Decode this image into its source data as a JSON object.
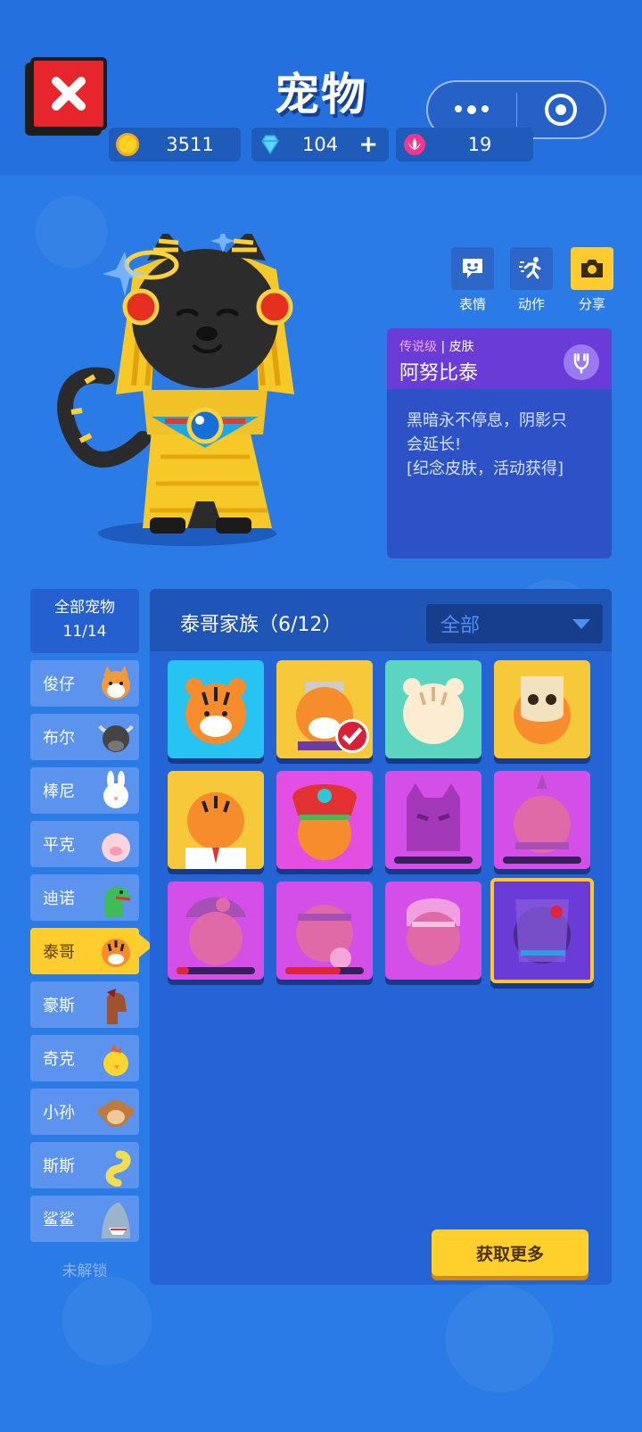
{
  "header": {
    "title": "宠物",
    "currencies": [
      {
        "icon": "coin-icon",
        "value": "3511"
      },
      {
        "icon": "diamond-icon",
        "value": "104",
        "plus": "+"
      },
      {
        "icon": "lotus-icon",
        "value": "19"
      }
    ]
  },
  "actions": [
    {
      "icon": "emote-icon",
      "label": "表情"
    },
    {
      "icon": "action-icon",
      "label": "动作"
    },
    {
      "icon": "camera-icon",
      "label": "分享"
    }
  ],
  "skin": {
    "rarity": "传说级",
    "separator": "|",
    "type": "皮肤",
    "name": "阿努比泰",
    "desc_line1": "黑暗永不停息，阴影只",
    "desc_line2": "会延长!",
    "desc_line3": "[纪念皮肤，活动获得]"
  },
  "sidebar": {
    "all_label": "全部宠物",
    "all_count": "11/14",
    "items": [
      {
        "label": "俊仔",
        "icon": "shiba-icon"
      },
      {
        "label": "布尔",
        "icon": "bull-icon"
      },
      {
        "label": "棒尼",
        "icon": "bunny-icon"
      },
      {
        "label": "平克",
        "icon": "pig-icon"
      },
      {
        "label": "迪诺",
        "icon": "dino-icon"
      },
      {
        "label": "泰哥",
        "icon": "tiger-icon",
        "active": true
      },
      {
        "label": "豪斯",
        "icon": "horse-icon"
      },
      {
        "label": "奇克",
        "icon": "chick-icon"
      },
      {
        "label": "小孙",
        "icon": "monkey-icon"
      },
      {
        "label": "斯斯",
        "icon": "snake-icon"
      },
      {
        "label": "鲨鲨",
        "icon": "shark-icon"
      }
    ],
    "locked_label": "未解锁"
  },
  "panel": {
    "family_title": "泰哥家族（6/12）",
    "filter": "全部",
    "get_more": "获取更多"
  },
  "colors": {
    "background": "#2a7be6",
    "accent_yellow": "#ffce2e",
    "legendary_purple": "#6b3bd8",
    "locked_magenta": "#d34fe8"
  }
}
